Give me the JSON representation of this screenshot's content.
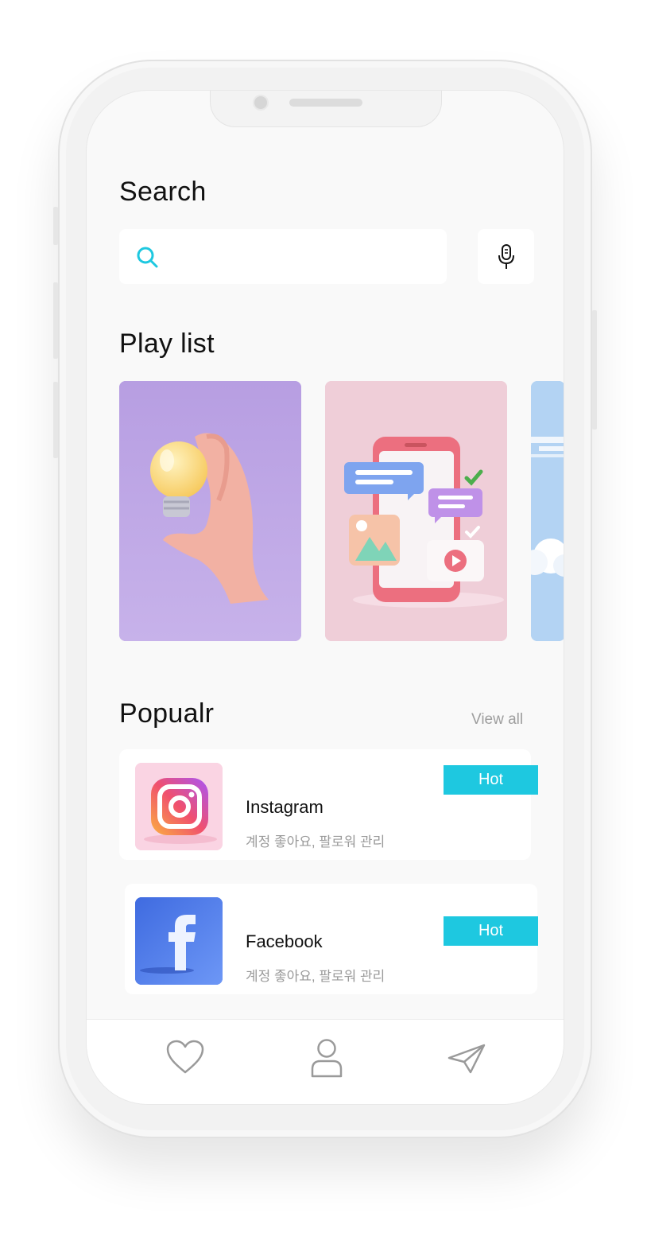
{
  "search": {
    "title": "Search",
    "placeholder": ""
  },
  "playlist": {
    "title": "Play list",
    "cards": [
      {
        "name": "lightbulb-hand",
        "bg": "#b9a0e3"
      },
      {
        "name": "phone-chat",
        "bg": "#efcdd8"
      },
      {
        "name": "cloud-sky",
        "bg": "#b3d3f3"
      }
    ]
  },
  "popular": {
    "title": "Popualr",
    "view_all": "View all",
    "items": [
      {
        "name": "Instagram",
        "desc": "계정 좋아요, 팔로워 관리",
        "badge": "Hot",
        "icon": "instagram-icon"
      },
      {
        "name": "Facebook",
        "desc": "계정 좋아요, 팔로워 관리",
        "badge": "Hot",
        "icon": "facebook-icon"
      }
    ]
  },
  "tabbar": {
    "icons": [
      "heart-icon",
      "user-icon",
      "send-icon"
    ]
  },
  "colors": {
    "accent": "#1ec8e0",
    "screen_bg": "#f9f9f9"
  }
}
